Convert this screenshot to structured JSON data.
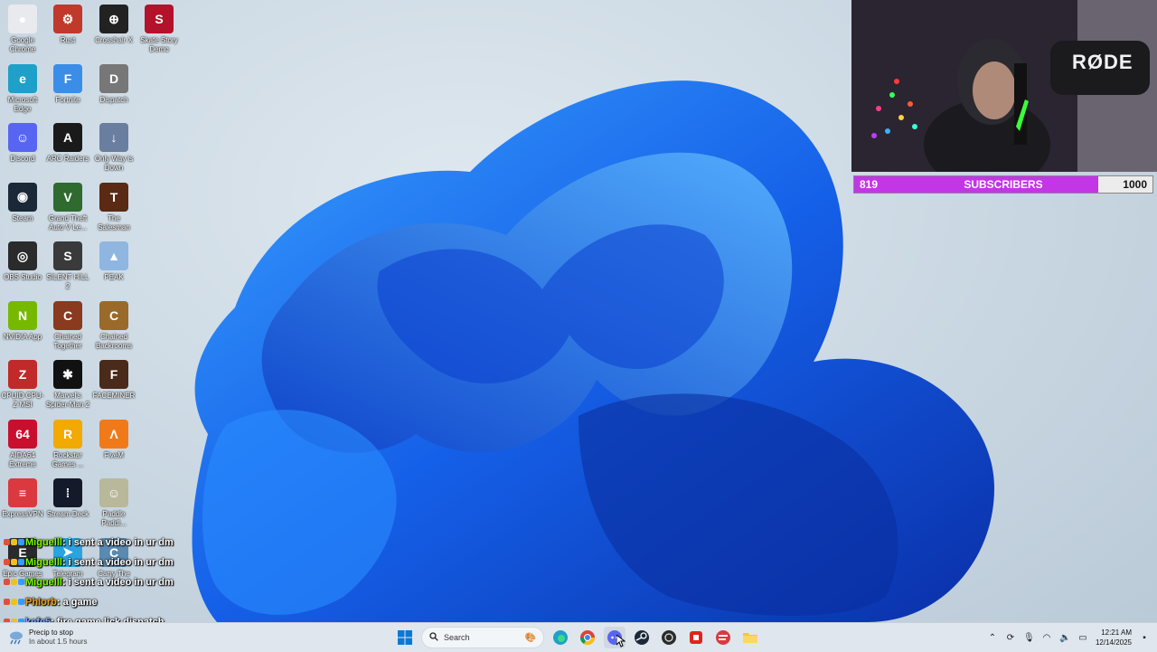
{
  "desktop": {
    "icons": [
      {
        "label": "Google Chrome",
        "icon": "chrome-icon",
        "color": "#e8eaed",
        "glyph": "●"
      },
      {
        "label": "Rust",
        "icon": "rust-icon",
        "color": "#c0392b",
        "glyph": "⚙"
      },
      {
        "label": "Crosshair X",
        "icon": "crosshair-icon",
        "color": "#222222",
        "glyph": "⊕"
      },
      {
        "label": "Skate Story Demo",
        "icon": "skate-story-icon",
        "color": "#b3122a",
        "glyph": "S"
      },
      {
        "label": "Microsoft Edge",
        "icon": "edge-icon",
        "color": "#1fa0c8",
        "glyph": "e"
      },
      {
        "label": "Fortnite",
        "icon": "fortnite-icon",
        "color": "#3b8ee8",
        "glyph": "F"
      },
      {
        "label": "Dispatch",
        "icon": "dispatch-icon",
        "color": "#777777",
        "glyph": "D"
      },
      {
        "label": "Discord",
        "icon": "discord-icon",
        "color": "#5865f2",
        "glyph": "☺"
      },
      {
        "label": "ARC Raiders",
        "icon": "arc-raiders-icon",
        "color": "#1a1a1a",
        "glyph": "A"
      },
      {
        "label": "Only Way is Down",
        "icon": "only-way-is-down-icon",
        "color": "#6a7fa0",
        "glyph": "↓"
      },
      {
        "label": "Steam",
        "icon": "steam-icon",
        "color": "#1b2838",
        "glyph": "◉"
      },
      {
        "label": "Grand Theft Auto V Le...",
        "icon": "gta-icon",
        "color": "#2f6b2f",
        "glyph": "V"
      },
      {
        "label": "The Salesman",
        "icon": "the-salesman-icon",
        "color": "#5a2a14",
        "glyph": "T"
      },
      {
        "label": "OBS Studio",
        "icon": "obs-icon",
        "color": "#2b2b2b",
        "glyph": "◎"
      },
      {
        "label": "SILENT HILL 2",
        "icon": "silent-hill-icon",
        "color": "#3a3a3a",
        "glyph": "S"
      },
      {
        "label": "PEAK",
        "icon": "peak-icon",
        "color": "#8fb6e0",
        "glyph": "▲"
      },
      {
        "label": "NVIDIA App",
        "icon": "nvidia-icon",
        "color": "#76b900",
        "glyph": "N"
      },
      {
        "label": "Chained Together",
        "icon": "chained-together-icon",
        "color": "#8a3a1e",
        "glyph": "C"
      },
      {
        "label": "Chained Backrooms",
        "icon": "chained-backrooms-icon",
        "color": "#9a6a2a",
        "glyph": "C"
      },
      {
        "label": "CPUID CPU-Z MSI",
        "icon": "cpuz-icon",
        "color": "#c02a2a",
        "glyph": "Z"
      },
      {
        "label": "Marvel's Spider-Man 2",
        "icon": "spiderman-icon",
        "color": "#111111",
        "glyph": "✱"
      },
      {
        "label": "FACEMINER",
        "icon": "faceminer-icon",
        "color": "#4a2a1a",
        "glyph": "F"
      },
      {
        "label": "AIDA64 Extreme",
        "icon": "aida64-icon",
        "color": "#c8102e",
        "glyph": "64"
      },
      {
        "label": "Rockstar Games ...",
        "icon": "rockstar-icon",
        "color": "#f2a900",
        "glyph": "R"
      },
      {
        "label": "FiveM",
        "icon": "fivem-icon",
        "color": "#f07a1a",
        "glyph": "Λ"
      },
      {
        "label": "ExpressVPN",
        "icon": "expressvpn-icon",
        "color": "#da3940",
        "glyph": "≡"
      },
      {
        "label": "Stream Deck",
        "icon": "stream-deck-icon",
        "color": "#141a2a",
        "glyph": "⁞"
      },
      {
        "label": "Paddle Paddl...",
        "icon": "paddle-icon",
        "color": "#b9b89a",
        "glyph": "☺"
      },
      {
        "label": "Epic Games",
        "icon": "epic-games-icon",
        "color": "#2a2a2a",
        "glyph": "E"
      },
      {
        "label": "Telegram",
        "icon": "telegram-icon",
        "color": "#2aa3df",
        "glyph": "➤"
      },
      {
        "label": "Carry The",
        "icon": "carry-the-icon",
        "color": "#5a8ab0",
        "glyph": "C"
      }
    ]
  },
  "webcam": {
    "brand_text": "RØDE"
  },
  "subscriber_goal": {
    "current": "819",
    "label": "SUBSCRIBERS",
    "target": "1000",
    "progress": 0.819,
    "fill_color": "#c236e6"
  },
  "chat": {
    "messages": [
      {
        "user": "Miguelll",
        "text": ": i sent a video in ur dm",
        "color": "#7CFC00"
      },
      {
        "user": "Miguelll",
        "text": ": i sent a video in ur dm",
        "color": "#7CFC00"
      },
      {
        "user": "Miguelll",
        "text": ": i sent a video in ur dm",
        "color": "#7CFC00"
      },
      {
        "user": "Phlorb",
        "text": ": a game",
        "color": "#f0a020"
      },
      {
        "user": "kefe5",
        "text": ": fire game lick dispatch",
        "color": "#7fa8ff"
      }
    ]
  },
  "taskbar": {
    "weather_title": "Precip to stop",
    "weather_subtitle": "In about 1.5 hours",
    "search_placeholder": "Search",
    "apps": [
      "start-icon",
      "edge-icon",
      "chrome-icon",
      "discord-icon",
      "steam-icon",
      "obs-icon",
      "roblox-icon",
      "expressvpn-icon",
      "file-explorer-icon"
    ],
    "time": "12:21 AM",
    "date": "12/14/2025"
  }
}
